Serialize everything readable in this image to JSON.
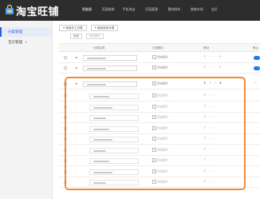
{
  "header": {
    "logo_text": "淘宝旺铺",
    "nav": [
      {
        "label": "智能版 ·"
      },
      {
        "label": "页面装修"
      },
      {
        "label": "手机淘宝 ·"
      },
      {
        "label": "页面管理 ·"
      },
      {
        "label": "素材制作 ·"
      },
      {
        "label": "装修市场"
      },
      {
        "label": "宝贝"
      }
    ]
  },
  "sidebar": {
    "items": [
      {
        "label": "分类管理"
      },
      {
        "label": "宝贝管理"
      }
    ]
  },
  "toolbar": {
    "add_manual_label": "添加手工分类",
    "add_auto_label": "添加自动分类",
    "pill_first": "全选",
    "pill_second": "批量删除"
  },
  "table": {
    "headers": [
      "分类名称",
      "分类图片",
      "移动",
      "默认"
    ],
    "add_image_label": "添加图片",
    "arrow_glyphs": "⇞ ↑ ↓ ⇟",
    "rows": [
      {
        "type": "top",
        "expanded": false,
        "toggle": "on"
      },
      {
        "type": "top",
        "expanded": false,
        "toggle": "on"
      },
      {
        "type": "top",
        "expanded": true,
        "toggle": "search"
      },
      {
        "type": "child"
      },
      {
        "type": "child"
      },
      {
        "type": "child"
      },
      {
        "type": "child"
      },
      {
        "type": "child"
      },
      {
        "type": "child"
      },
      {
        "type": "child"
      },
      {
        "type": "child"
      },
      {
        "type": "child"
      }
    ]
  },
  "colors": {
    "topbar": "#2d2d2d",
    "accent_blue": "#1f7bf4",
    "highlight_orange": "#f08a38"
  },
  "icons": {
    "logo": "shop-bag-icon",
    "expand": "triangle-right-icon",
    "collapse": "triangle-down-icon",
    "image": "image-plus-icon",
    "move": "move-arrows-icon"
  }
}
